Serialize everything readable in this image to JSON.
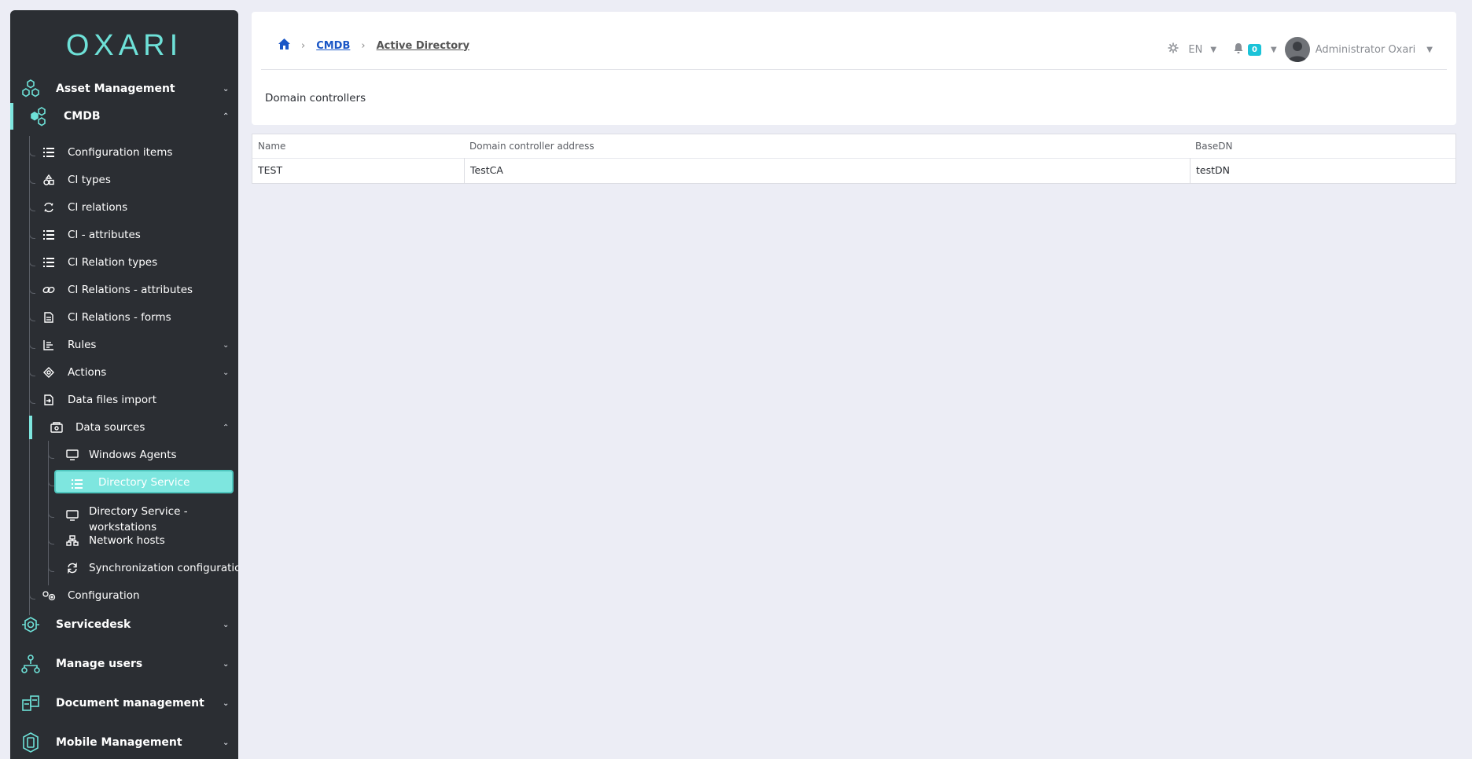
{
  "logo": {
    "text": "OXARI"
  },
  "sidebar": {
    "top_items": [
      {
        "label": "Asset Management",
        "icon": "hexagons-icon"
      },
      {
        "label": "CMDB",
        "icon": "cmdb-icon"
      },
      {
        "label": "Servicedesk",
        "icon": "servicedesk-icon"
      },
      {
        "label": "Manage users",
        "icon": "users-tree-icon"
      },
      {
        "label": "Document management",
        "icon": "documents-icon"
      },
      {
        "label": "Mobile Management",
        "icon": "mobile-icon"
      }
    ],
    "cmdb_items": [
      {
        "label": "Configuration items",
        "icon": "list-icon"
      },
      {
        "label": "CI types",
        "icon": "shapes-icon"
      },
      {
        "label": "CI relations",
        "icon": "swap-icon"
      },
      {
        "label": "CI - attributes",
        "icon": "list-icon"
      },
      {
        "label": "CI Relation types",
        "icon": "list-icon"
      },
      {
        "label": "CI Relations - attributes",
        "icon": "link-icon"
      },
      {
        "label": "CI Relations - forms",
        "icon": "form-icon"
      },
      {
        "label": "Rules",
        "icon": "rules-icon"
      },
      {
        "label": "Actions",
        "icon": "actions-icon"
      },
      {
        "label": "Data files import",
        "icon": "file-import-icon"
      },
      {
        "label": "Data sources",
        "icon": "data-sources-icon"
      },
      {
        "label": "Configuration",
        "icon": "gears-icon"
      }
    ],
    "data_sources_items": [
      {
        "label": "Windows Agents",
        "icon": "monitor-icon"
      },
      {
        "label": "Directory Service",
        "icon": "list-icon"
      },
      {
        "label": "Directory Service -",
        "label2": "workstations",
        "icon": "monitor-icon"
      },
      {
        "label": "Network hosts",
        "icon": "network-icon"
      },
      {
        "label": "Synchronization configuration",
        "icon": "sync-icon"
      }
    ]
  },
  "breadcrumb": {
    "home_icon": "home-icon",
    "items": [
      "CMDB",
      "Active Directory"
    ]
  },
  "header": {
    "language": "EN",
    "notifications": "0",
    "user": "Administrator Oxari"
  },
  "page": {
    "title": "Domain controllers"
  },
  "table": {
    "columns": [
      "Name",
      "Domain controller address",
      "BaseDN"
    ],
    "rows": [
      [
        "TEST",
        "TestCA",
        "testDN"
      ]
    ]
  },
  "colors": {
    "accent": "#7ee6df",
    "sidebar_bg": "#2b2e33",
    "link": "#1a56c6",
    "badge": "#1bc3d8"
  }
}
